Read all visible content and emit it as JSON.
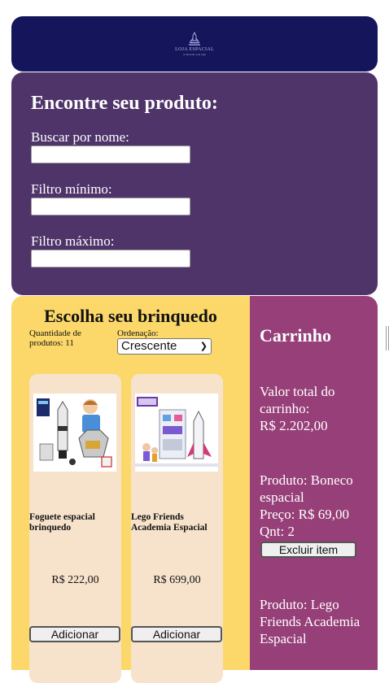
{
  "header": {
    "logo_name": "LOJA ESPACIAL",
    "logo_tagline": "A diversão está aqui"
  },
  "filters": {
    "title": "Encontre seu produto:",
    "search_label": "Buscar por nome:",
    "search_value": "",
    "min_label": "Filtro mínimo:",
    "min_value": "",
    "max_label": "Filtro máximo:",
    "max_value": ""
  },
  "products": {
    "title": "Escolha seu brinquedo",
    "quantity_text": "Quantidade de produtos: 11",
    "sort_label": "Ordenação:",
    "sort_selected": "Crescente",
    "items": [
      {
        "name": "Foguete espacial brinquedo",
        "price": "R$ 222,00",
        "button": "Adicionar",
        "image_icon": "rocket-toy-image"
      },
      {
        "name": "Lego Friends Academia Espacial",
        "price": "R$ 699,00",
        "button": "Adicionar",
        "image_icon": "lego-space-academy-image"
      }
    ]
  },
  "cart": {
    "title": "Carrinho",
    "total_label": "Valor total do carrinho:",
    "total_value": "R$ 2.202,00",
    "items": [
      {
        "product": "Produto: Boneco espacial",
        "price": "Preço: R$ 69,00",
        "qty": "Qnt: 2",
        "remove": "Excluir item"
      },
      {
        "product": "Produto: Lego Friends Academia Espacial"
      }
    ]
  },
  "colors": {
    "header_bg": "#14155a",
    "filters_bg": "#4f346a",
    "products_bg": "#fcd76a",
    "card_bg": "#f7e3cb",
    "cart_bg": "#963f78"
  }
}
